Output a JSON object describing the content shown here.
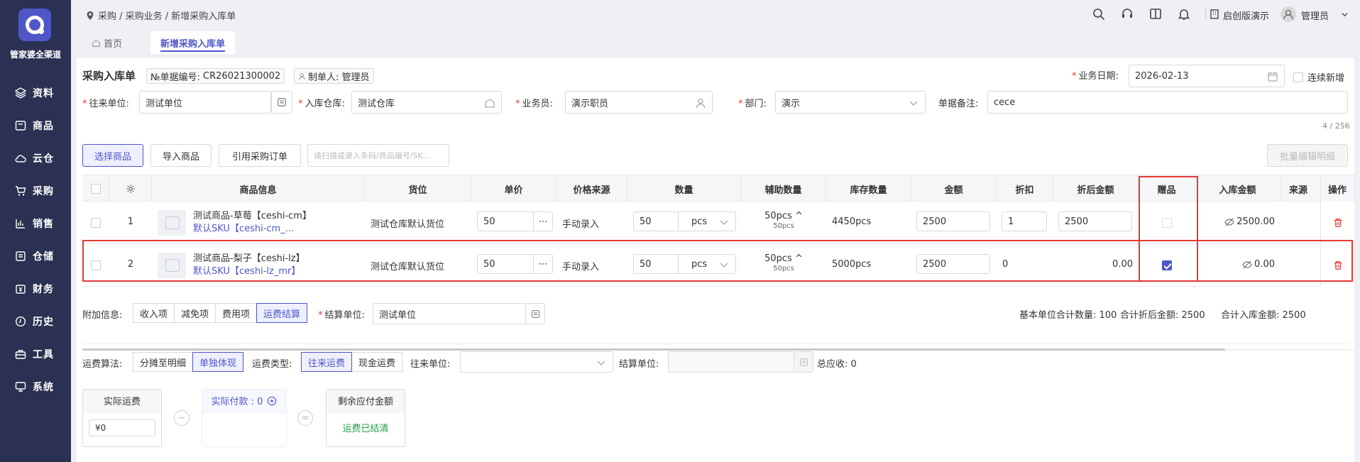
{
  "sidebar": {
    "brand": "管家婆全渠道",
    "items": [
      {
        "label": "资料",
        "icon": "layers-icon"
      },
      {
        "label": "商品",
        "icon": "box-icon"
      },
      {
        "label": "云仓",
        "icon": "cloud-icon"
      },
      {
        "label": "采购",
        "icon": "cart-icon"
      },
      {
        "label": "销售",
        "icon": "chart-icon"
      },
      {
        "label": "仓储",
        "icon": "warehouse-icon"
      },
      {
        "label": "财务",
        "icon": "finance-icon"
      },
      {
        "label": "历史",
        "icon": "clock-icon"
      },
      {
        "label": "工具",
        "icon": "toolbox-icon"
      },
      {
        "label": "系统",
        "icon": "monitor-icon"
      }
    ]
  },
  "topbar": {
    "breadcrumb": "采购 / 采购业务 / 新增采购入库单",
    "edition": "启创版演示",
    "user": "管理员"
  },
  "tabs": [
    {
      "label": "首页"
    },
    {
      "label": "新增采购入库单"
    }
  ],
  "form": {
    "title": "采购入库单",
    "bill_no_label": "№单据编号:",
    "bill_no": "CR26021300002",
    "maker_label": "制单人:",
    "maker": "管理员",
    "biz_date_label": "业务日期:",
    "biz_date": "2026-02-13",
    "continuous_label": "连续新增",
    "partner_label": "往来单位:",
    "partner": "测试单位",
    "warehouse_label": "入库仓库:",
    "warehouse": "测试仓库",
    "clerk_label": "业务员:",
    "clerk": "演示职员",
    "dept_label": "部门:",
    "dept": "演示",
    "remark_label": "单据备注:",
    "remark": "cece",
    "remark_counter": "4 / 256"
  },
  "toolbar": {
    "select_goods": "选择商品",
    "import_goods": "导入商品",
    "ref_order": "引用采购订单",
    "scan_placeholder": "请扫描或录入条码/商品编号/SK...",
    "batch_edit": "批量编辑明细"
  },
  "table": {
    "headers": [
      "商品信息",
      "货位",
      "单价",
      "价格来源",
      "数量",
      "辅助数量",
      "库存数量",
      "金额",
      "折扣",
      "折后金额",
      "赠品",
      "入库金额",
      "来源",
      "操作"
    ],
    "rows": [
      {
        "no": "1",
        "name": "测试商品-草莓【ceshi-cm】",
        "sku": "默认SKU【ceshi-cm_...",
        "location": "测试仓库默认货位",
        "price": "50",
        "price_source": "手动录入",
        "qty": "50",
        "unit": "pcs",
        "aux_qty": "50pcs",
        "aux_qty_sub": "50pcs",
        "stock": "4450pcs",
        "amount": "2500",
        "discount": "1",
        "disc_amount": "2500",
        "gift": false,
        "in_amount": "2500.00"
      },
      {
        "no": "2",
        "name": "测试商品-梨子【ceshi-lz】",
        "sku": "默认SKU【ceshi-lz_mr】",
        "location": "测试仓库默认货位",
        "price": "50",
        "price_source": "手动录入",
        "qty": "50",
        "unit": "pcs",
        "aux_qty": "50pcs",
        "aux_qty_sub": "50pcs",
        "stock": "5000pcs",
        "amount": "2500",
        "discount": "0",
        "disc_amount": "0.00",
        "gift": true,
        "in_amount": "0.00"
      }
    ]
  },
  "extra": {
    "label": "附加信息:",
    "tabs": [
      "收入项",
      "减免项",
      "费用项",
      "运费结算"
    ],
    "settle_label": "结算单位:",
    "settle_value": "测试单位",
    "sum_qty": "基本单位合计数量: 100",
    "sum_disc": "合计折后金额: 2500",
    "sum_in": "合计入库金额: 2500"
  },
  "freight": {
    "algo_label": "运费算法:",
    "algo_options": [
      "分摊至明细",
      "单独体现"
    ],
    "type_label": "运费类型:",
    "type_options": [
      "往来运费",
      "现金运费"
    ],
    "partner_label": "往来单位:",
    "settle_label": "结算单位:",
    "total_label": "总应收:",
    "total": "0",
    "actual_freight": "实际运费",
    "actual_freight_value": "¥0",
    "actual_paid": "实际付款 : 0",
    "remaining": "剩余应付金额",
    "settled": "运费已结清"
  }
}
